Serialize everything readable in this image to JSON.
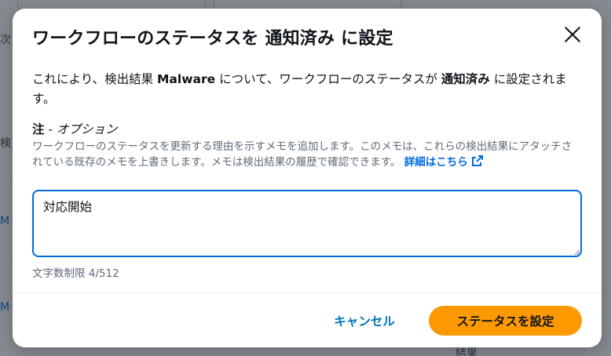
{
  "background": {
    "fragments": [
      "次",
      "検",
      "M",
      "M",
      "結果"
    ]
  },
  "modal": {
    "title": "ワークフローのステータスを 通知済み に設定",
    "close_icon": "close-icon",
    "description": {
      "part1": "これにより、検出結果 ",
      "finding_name": "Malware",
      "part2": " について、ワークフローのステータスが ",
      "status": "通知済み",
      "part3": " に設定されます。"
    },
    "note_field": {
      "label": "注",
      "label_separator": " - ",
      "optional": "オプション",
      "description": "ワークフローのステータスを更新する理由を示すメモを追加します。このメモは、これらの検出結果にアタッチされている既存のメモを上書きします。メモは検出結果の履歴で確認できます。",
      "learn_more": "詳細はこちら",
      "learn_more_icon": "external-link-icon",
      "value": "対応開始",
      "char_count": "文字数制限 4/512"
    },
    "footer": {
      "cancel_label": "キャンセル",
      "submit_label": "ステータスを設定"
    }
  },
  "colors": {
    "primary_button": "#ff9900",
    "focus_border": "#006ce0",
    "link": "#006ce0"
  }
}
